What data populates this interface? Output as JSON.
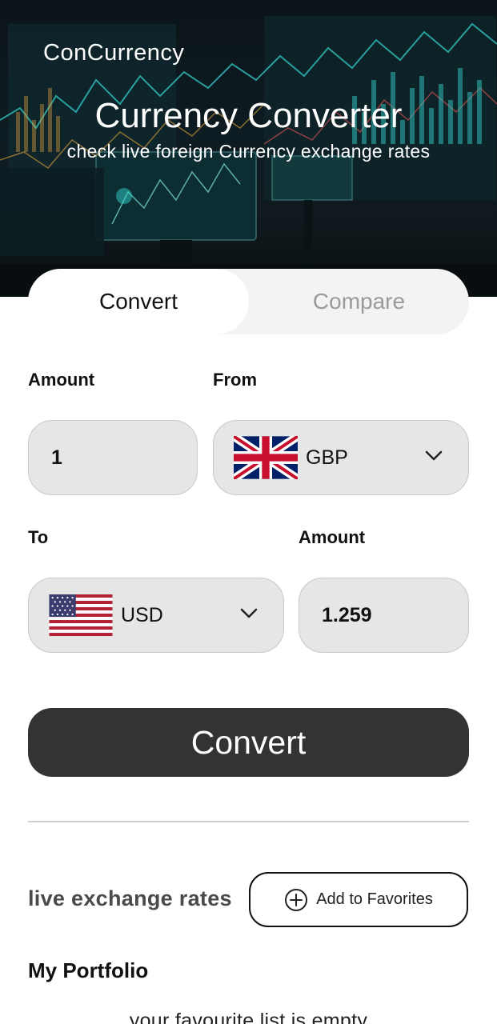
{
  "header": {
    "app_name": "ConCurrency",
    "title": "Currency Converter",
    "subtitle": "check live foreign Currency exchange rates"
  },
  "tabs": [
    {
      "label": "Convert",
      "active": true
    },
    {
      "label": "Compare",
      "active": false
    }
  ],
  "form": {
    "amount_label": "Amount",
    "from_label": "From",
    "amount_value": "1",
    "from_currency": "GBP",
    "to_label": "To",
    "result_label": "Amount",
    "to_currency": "USD",
    "result_value": "1.259"
  },
  "actions": {
    "convert_label": "Convert",
    "add_favorites_label": "Add to Favorites"
  },
  "live_rates_label": "live exchange rates",
  "portfolio": {
    "title": "My Portfolio",
    "empty_message": "your favourite list is empty"
  },
  "icons": {
    "from_flag": "uk-flag-icon",
    "to_flag": "us-flag-icon",
    "dropdown": "chevron-down-icon",
    "add": "plus-circle-icon"
  },
  "colors": {
    "button": "#333333",
    "field_bg": "#e6e6e6",
    "tab_inactive_text": "#9a9a9a"
  }
}
